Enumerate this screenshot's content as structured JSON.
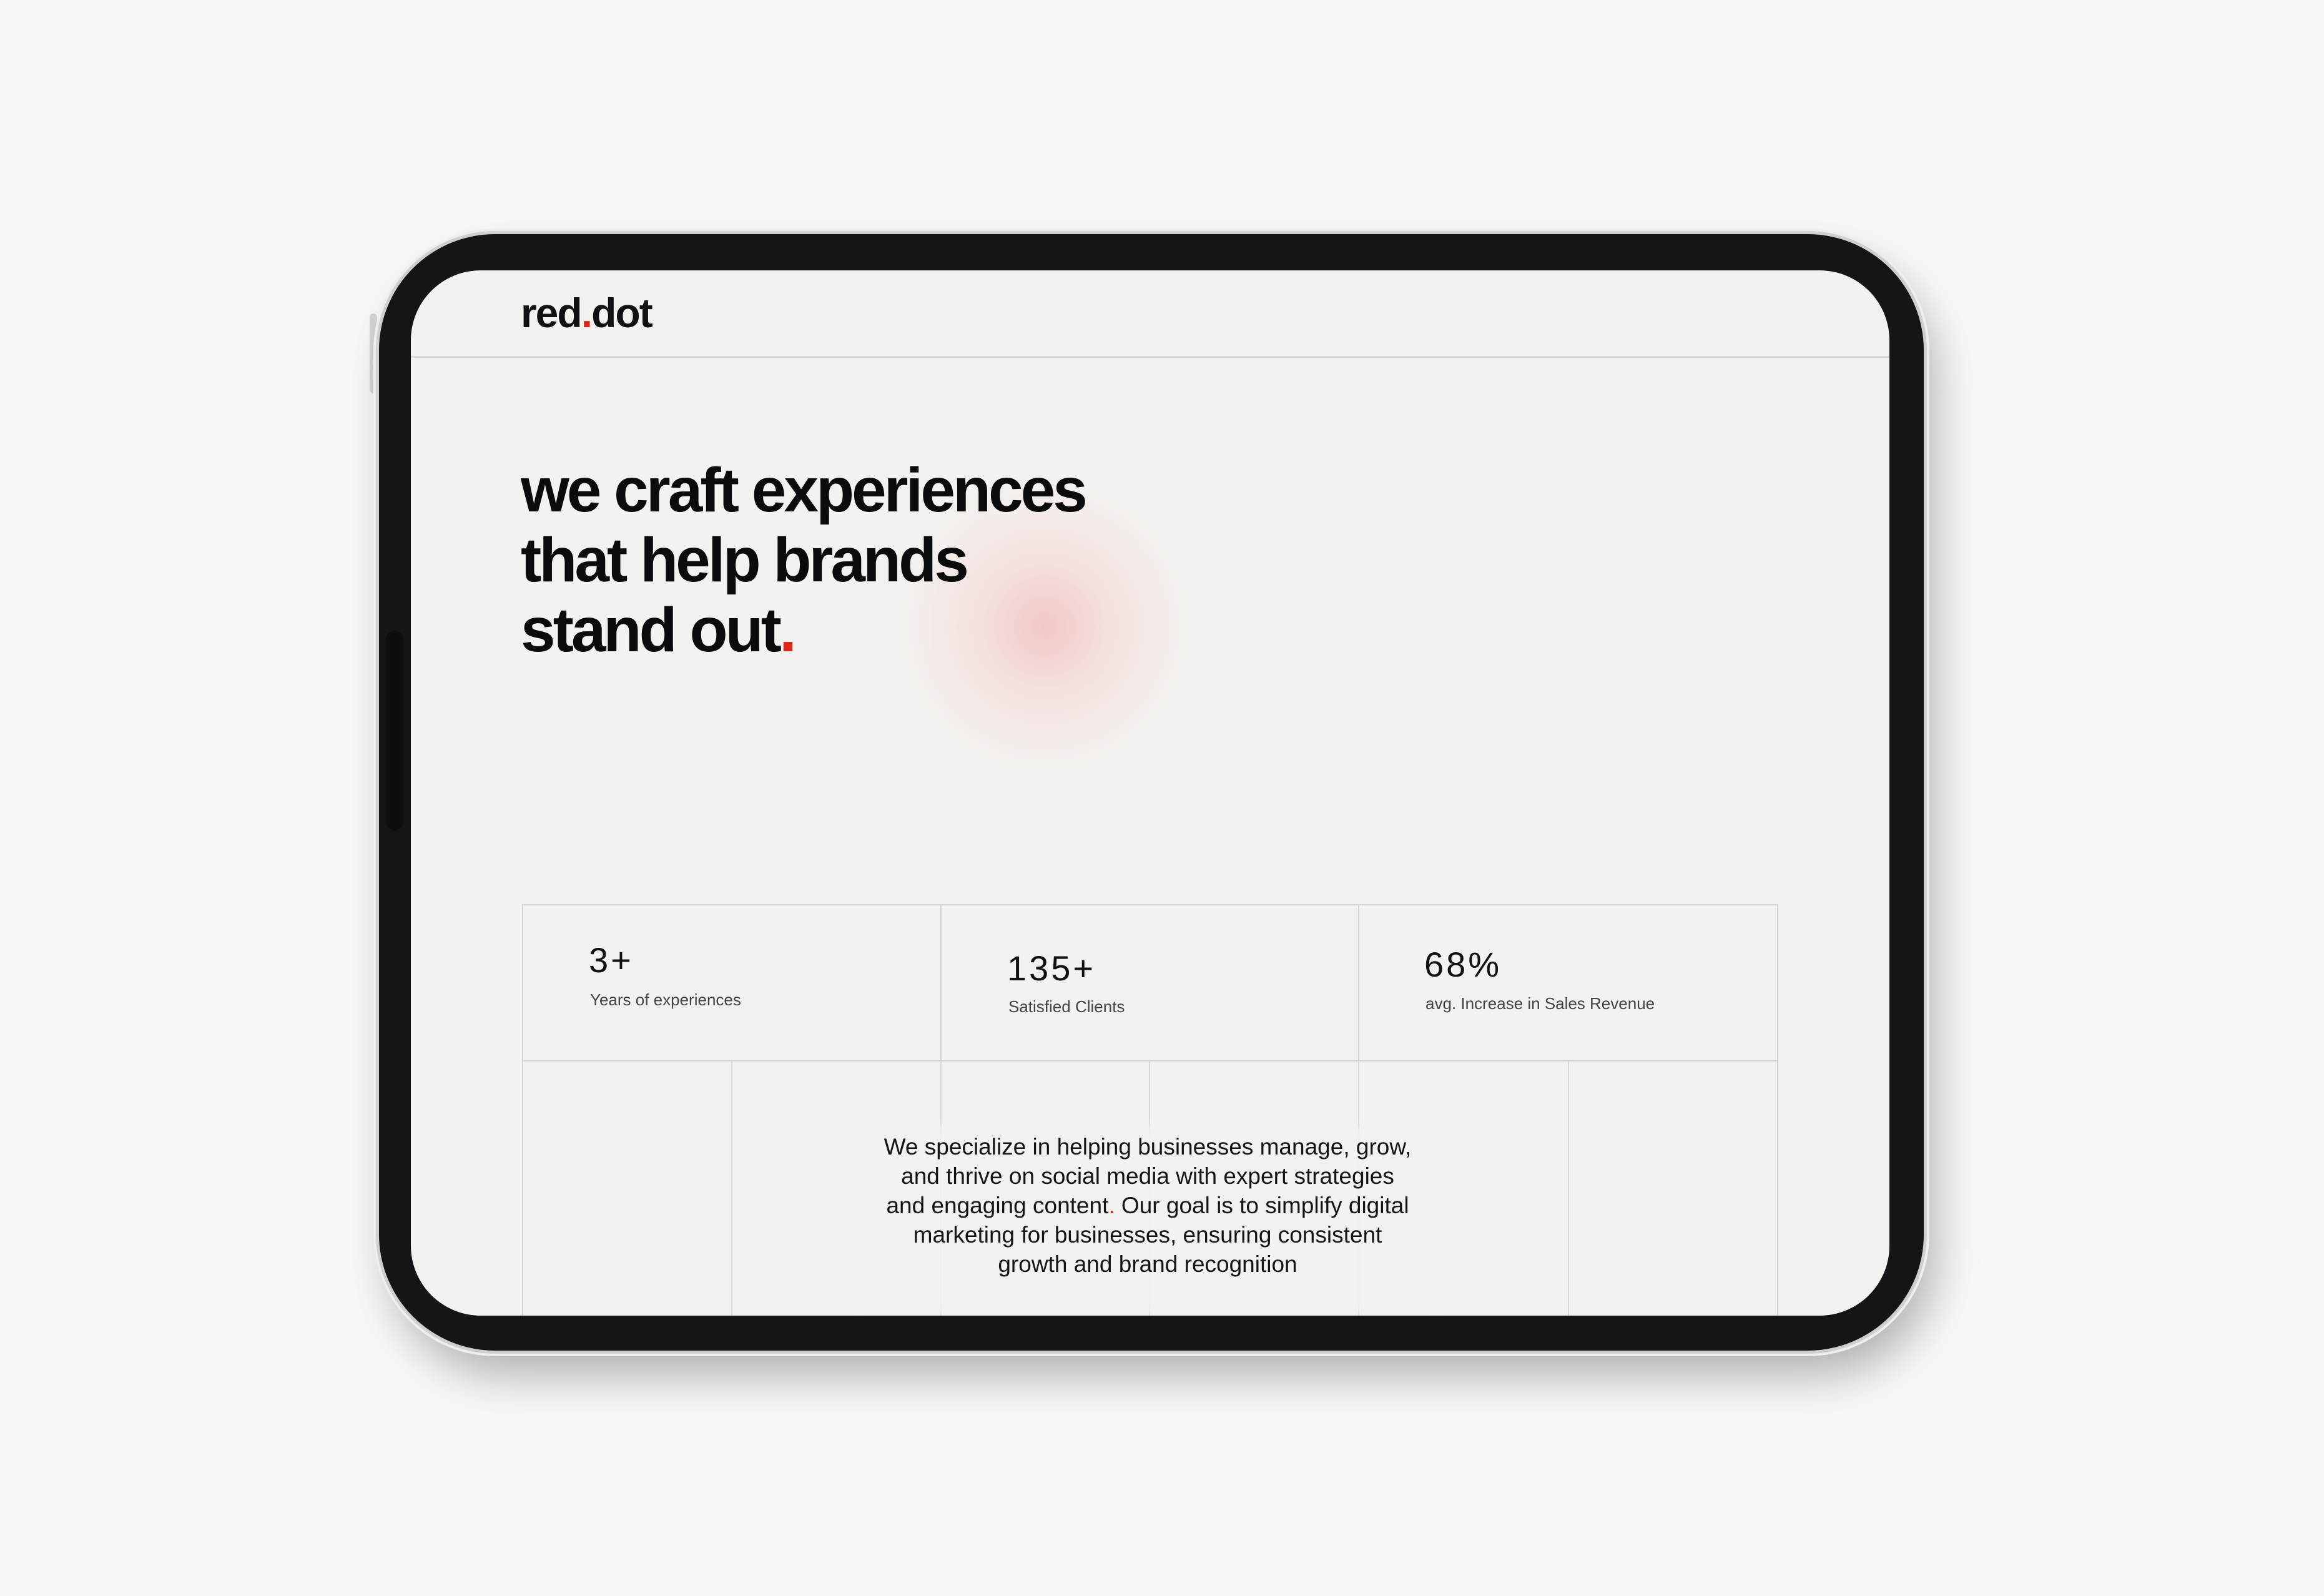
{
  "brand": {
    "logo_prefix": "red",
    "logo_dot": ".",
    "logo_suffix": "dot"
  },
  "hero": {
    "line1": "we craft experiences",
    "line2": "that help brands",
    "line3": "stand out",
    "accent_dot": "."
  },
  "stats": [
    {
      "value": "3+",
      "label": "Years of experiences"
    },
    {
      "value": "135+",
      "label": "Satisfied Clients"
    },
    {
      "value": "68%",
      "label": "avg. Increase in Sales Revenue"
    }
  ],
  "intro": {
    "line1": "We specialize in helping businesses manage, grow,",
    "line2": "and thrive on social media with expert strategies",
    "line3_start": "and engaging content",
    "line3_dot": ".",
    "line3_end": " Our goal is to simplify digital",
    "line4": "marketing for businesses, ensuring consistent",
    "line5": "growth and brand recognition"
  },
  "colors": {
    "accent": "#e0261b",
    "screen_background": "#f3f2ef",
    "page_background": "#f7f7f7",
    "device_frame": "#151515",
    "text": "#111111",
    "grid_lines": "#d5d4d1"
  }
}
